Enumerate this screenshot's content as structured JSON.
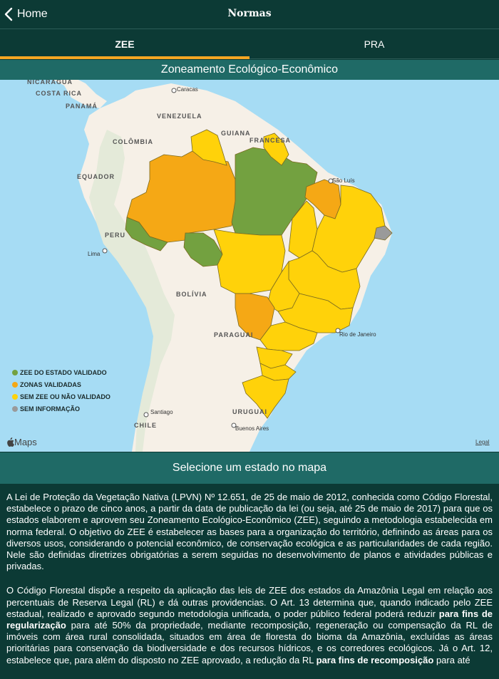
{
  "nav": {
    "back_label": "Home",
    "title": "Normas"
  },
  "tabs": [
    {
      "label": "ZEE",
      "active": true
    },
    {
      "label": "PRA",
      "active": false
    }
  ],
  "map_title": "Zoneamento Ecológico-Econômico",
  "map": {
    "country_labels": [
      "NICARAGUA",
      "COSTA RICA",
      "PANAMÁ",
      "VENEZUELA",
      "COLÔMBIA",
      "GUIANA",
      "FRANCESA",
      "EQUADOR",
      "PERU",
      "BOLÍVIA",
      "PARAGUAI",
      "URUGUAI",
      "CHILE"
    ],
    "city_labels": [
      "Caracas",
      "São Luís",
      "Lima",
      "Rio de Janeiro",
      "Santiago",
      "Buenos Aires"
    ],
    "attribution": "Maps",
    "legal": "Legal",
    "colors": {
      "validated_state": "#73a140",
      "validated_zones": "#f5a815",
      "not_validated": "#ffd20a",
      "no_info": "#9a9a9a",
      "ocean": "#a6dcf4",
      "land": "#f6f0e7"
    }
  },
  "legend": [
    {
      "label": "ZEE DO ESTADO VALIDADO",
      "color": "#73a140"
    },
    {
      "label": "ZONAS VALIDADAS",
      "color": "#f5a815"
    },
    {
      "label": "SEM ZEE OU NÃO VALIDADO",
      "color": "#ffd20a"
    },
    {
      "label": "SEM INFORMAÇÃO",
      "color": "#9a9a9a"
    }
  ],
  "select_prompt": "Selecione um estado no mapa",
  "paragraphs": {
    "p1": "A Lei de Proteção da Vegetação Nativa (LPVN) Nº 12.651, de 25 de maio de 2012, conhecida como Código Florestal, estabelece o prazo de cinco anos, a partir da data de publicação da lei (ou seja, até 25 de maio de 2017) para que os estados elaborem e aprovem seu Zoneamento Ecológico-Econômico (ZEE), seguindo a metodologia estabelecida em norma federal. O objetivo do ZEE é estabelecer as bases para a organização do território, definindo as áreas para os diversos usos, considerando o potencial econômico, de conservação ecológica e as particularidades de cada região. Nele são definidas diretrizes obrigatórias a serem seguidas no desenvolvimento de planos e atividades públicas e privadas.",
    "p2_a": "O Código Florestal dispõe a respeito da aplicação das leis de ZEE dos estados da Amazônia Legal em relação aos percentuais de Reserva Legal (RL) e dá outras providencias. O Art. 13 determina que, quando indicado pelo ZEE estadual, realizado e aprovado segundo metodologia unificada, o poder público federal poderá reduzir ",
    "p2_b": "para fins de regularização",
    "p2_c": " para até 50% da propriedade, mediante recomposição, regeneração ou compensação da RL de imóveis com área rural consolidada, situados em área de floresta do bioma da Amazônia, excluídas as áreas prioritárias para conservação da biodiversidade e dos recursos hídricos, e os corredores ecológicos.  Já o Art. 12, estabelece que, para além do disposto no ZEE aprovado, a redução da RL ",
    "p2_d": "para fins de recomposição",
    "p2_e": " para até"
  }
}
